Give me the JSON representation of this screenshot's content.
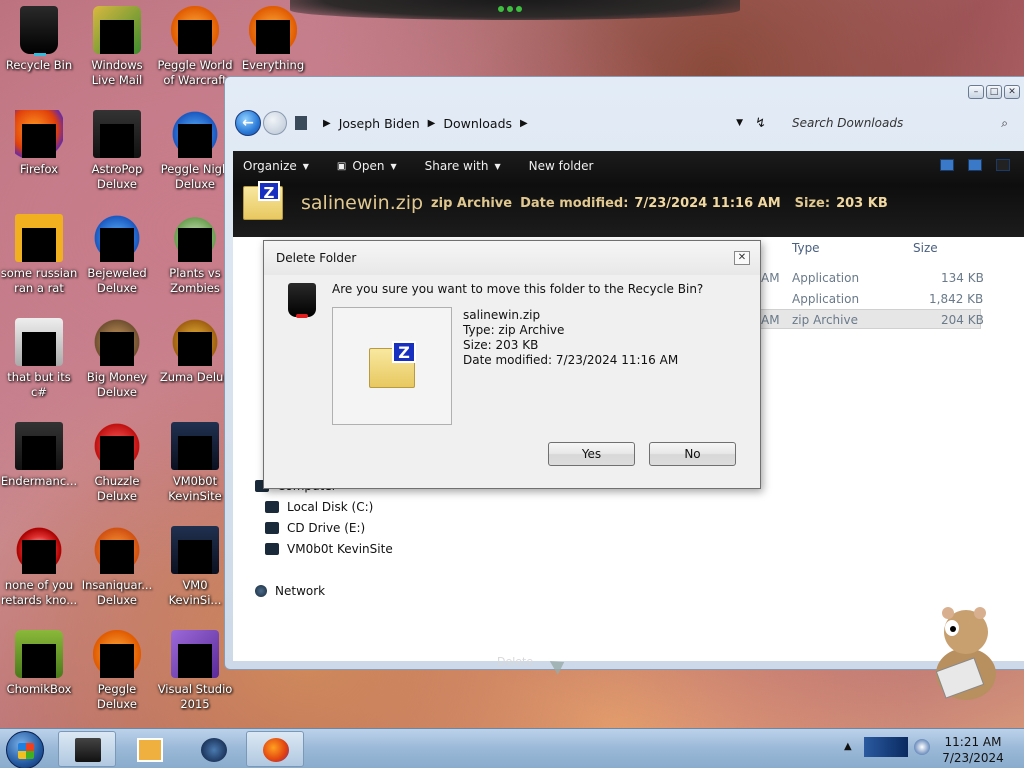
{
  "desktop": {
    "icons": [
      {
        "label": "Recycle Bin",
        "icon": "recycle-bin-icon"
      },
      {
        "label": "Windows Live Mail",
        "icon": "windows-live-mail-icon"
      },
      {
        "label": "Peggle World of Warcraft",
        "icon": "peggle-wow-icon"
      },
      {
        "label": "Everything",
        "icon": "everything-icon"
      },
      {
        "label": "Firefox",
        "icon": "firefox-icon"
      },
      {
        "label": "AstroPop Deluxe",
        "icon": "astropop-icon"
      },
      {
        "label": "Peggle Nigh Deluxe",
        "icon": "peggle-nights-icon"
      },
      {
        "label": "some russian ran a rat",
        "icon": "e-icon"
      },
      {
        "label": "Bejeweled Deluxe",
        "icon": "bejeweled-icon"
      },
      {
        "label": "Plants vs Zombies",
        "icon": "plants-vs-zombies-icon"
      },
      {
        "label": "that but its c#",
        "icon": "copy-icon"
      },
      {
        "label": "Big Money Deluxe",
        "icon": "big-money-icon"
      },
      {
        "label": "Zuma Delux",
        "icon": "zuma-icon"
      },
      {
        "label": "Endermanc...",
        "icon": "endermanch-icon"
      },
      {
        "label": "Chuzzle Deluxe",
        "icon": "chuzzle-icon"
      },
      {
        "label": "VM0b0t KevinSite",
        "icon": "vm-icon"
      },
      {
        "label": "none of you retards kno...",
        "icon": "red-ball-icon"
      },
      {
        "label": "Insaniquar... Deluxe",
        "icon": "insaniquarium-icon"
      },
      {
        "label": "VM0 KevinSi...",
        "icon": "vm-icon"
      },
      {
        "label": "ChomikBox",
        "icon": "chomikbox-icon"
      },
      {
        "label": "Peggle Deluxe",
        "icon": "peggle-icon"
      },
      {
        "label": "Visual Studio 2015",
        "icon": "visual-studio-icon"
      }
    ]
  },
  "explorer": {
    "breadcrumb": [
      "Joseph Biden",
      "Downloads"
    ],
    "search_placeholder": "Search Downloads",
    "toolbar": {
      "organize": "Organize",
      "open": "Open",
      "share_with": "Share with",
      "new_folder": "New folder"
    },
    "details": {
      "name": "salinewin.zip",
      "type": "zip Archive",
      "date_label": "Date modified:",
      "date_value": "7/23/2024 11:16 AM",
      "size_label": "Size:",
      "size_value": "203 KB"
    },
    "columns": {
      "type": "Type",
      "size": "Size"
    },
    "files": [
      {
        "time_fragment": "AM",
        "type": "Application",
        "size": "134 KB"
      },
      {
        "time_fragment": "",
        "type": "Application",
        "size": "1,842 KB"
      },
      {
        "time_fragment": "AM",
        "type": "zip Archive",
        "size": "204 KB"
      }
    ],
    "nav": {
      "computer": "Computer",
      "local_disk": "Local Disk (C:)",
      "cd_drive": "CD Drive (E:)",
      "vm_share": "VM0b0t KevinSite",
      "network": "Network"
    },
    "ghost_label": "Delete"
  },
  "dialog": {
    "title": "Delete Folder",
    "question": "Are you sure you want to move this folder to the Recycle Bin?",
    "file_name": "salinewin.zip",
    "file_type": "Type: zip Archive",
    "file_size": "Size: 203 KB",
    "file_date": "Date modified: 7/23/2024 11:16 AM",
    "yes": "Yes",
    "no": "No"
  },
  "taskbar": {
    "time": "11:21 AM",
    "date": "7/23/2024"
  }
}
